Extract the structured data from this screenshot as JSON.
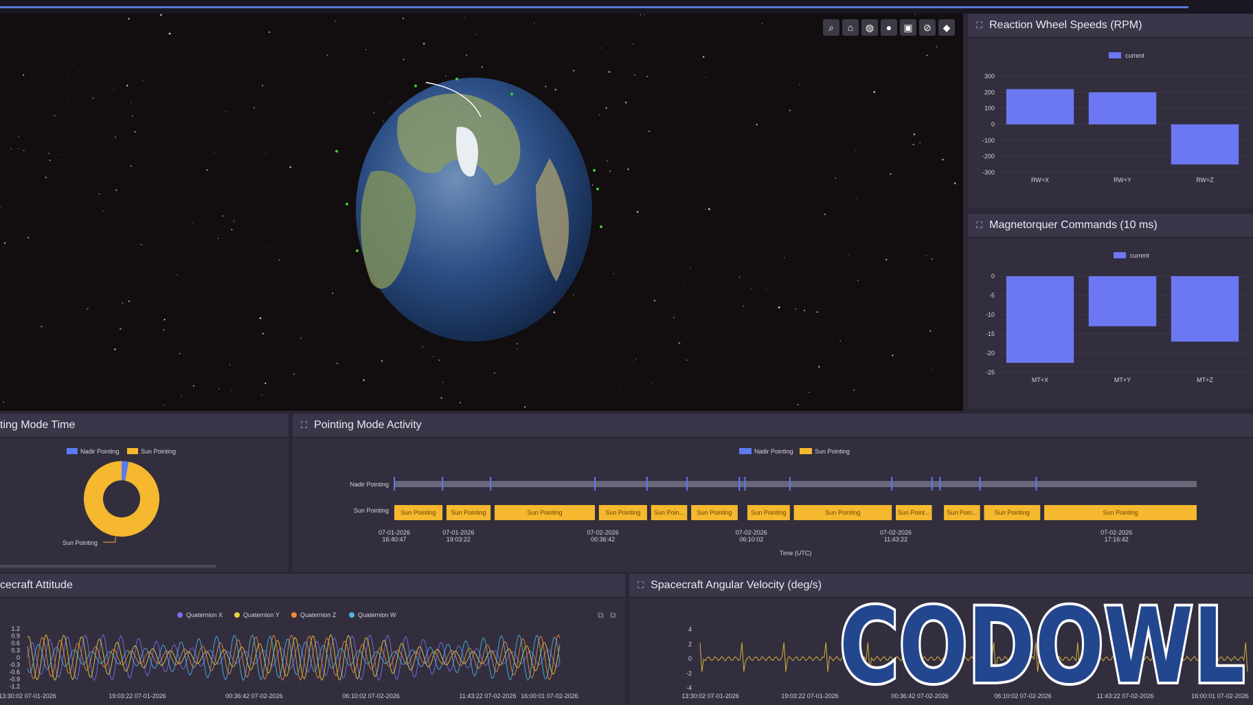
{
  "toolbar": {
    "buttons": [
      {
        "icon": "search-icon",
        "glyph": "⌕"
      },
      {
        "icon": "home-icon",
        "glyph": "⌂"
      },
      {
        "icon": "globe-icon",
        "glyph": "◍"
      },
      {
        "icon": "help-icon",
        "glyph": "●"
      },
      {
        "icon": "layers-icon",
        "glyph": "▣"
      },
      {
        "icon": "compass-icon",
        "glyph": "⊘"
      },
      {
        "icon": "settings-icon",
        "glyph": "◆"
      }
    ]
  },
  "panels": {
    "reaction_wheel": {
      "title": "Reaction Wheel Speeds (RPM)"
    },
    "magnetorquer": {
      "title": "Magnetorquer Commands (10 ms)"
    },
    "pointing_time": {
      "title": "ting Mode Time"
    },
    "pointing_activity": {
      "title": "Pointing Mode Activity"
    },
    "attitude": {
      "title": "cecraft Attitude"
    },
    "angular_velocity": {
      "title": "Spacecraft Angular Velocity (deg/s)"
    }
  },
  "colors": {
    "nadir": "#5b7bf0",
    "sun": "#f5b82e",
    "bar": "#6b78f2",
    "qx": "#7b6ff0",
    "qy": "#e8d23a",
    "qz": "#f08a3a",
    "qw": "#4fb3e8",
    "vel": "#d9b23a"
  },
  "chart_data": [
    {
      "type": "bar",
      "title": "Reaction Wheel Speeds (RPM)",
      "categories": [
        "RW+X",
        "RW+Y",
        "RW+Z"
      ],
      "series": [
        {
          "name": "current",
          "values": [
            220,
            200,
            -250
          ]
        }
      ],
      "yticks": [
        "300",
        "200",
        "100",
        "0",
        "-100",
        "-200",
        "-300"
      ],
      "ylim": [
        -300,
        300
      ]
    },
    {
      "type": "bar",
      "title": "Magnetorquer Commands (10 ms)",
      "categories": [
        "MT+X",
        "MT+Y",
        "MT+Z"
      ],
      "series": [
        {
          "name": "current",
          "values": [
            -22.5,
            -13,
            -17
          ]
        }
      ],
      "yticks": [
        "0",
        "-5",
        "-10",
        "-15",
        "-20",
        "-25"
      ],
      "ylim": [
        -25,
        0
      ]
    },
    {
      "type": "pie",
      "title": "ting Mode Time",
      "legend": [
        "Nadir Pointing",
        "Sun Pointing"
      ],
      "values": [
        3,
        97
      ],
      "slice_label": "Sun Pointing"
    },
    {
      "type": "bar",
      "title": "Pointing Mode Activity",
      "legend": [
        "Nadir Pointing",
        "Sun Pointing"
      ],
      "rows": [
        "Nadir Pointing",
        "Sun Pointing"
      ],
      "xlabel": "Time (UTC)",
      "xticks": [
        {
          "date": "07-01-2026",
          "time": "16:40:47"
        },
        {
          "date": "07-01-2026",
          "time": "19:03:22"
        },
        {
          "date": "07-02-2026",
          "time": "00:36:42"
        },
        {
          "date": "07-02-2026",
          "time": "06:10:02"
        },
        {
          "date": "07-02-2026",
          "time": "11:43:22"
        },
        {
          "date": "07-02-2026",
          "time": "17:16:42"
        }
      ],
      "nadir_marks": [
        0.0,
        0.06,
        0.12,
        0.25,
        0.315,
        0.365,
        0.43,
        0.437,
        0.493,
        0.62,
        0.67,
        0.68,
        0.73,
        0.8
      ],
      "sun_segments": [
        {
          "start": 0.0,
          "end": 0.06,
          "label": "Sun Pointing"
        },
        {
          "start": 0.065,
          "end": 0.12,
          "label": "Sun Pointing"
        },
        {
          "start": 0.125,
          "end": 0.25,
          "label": "Sun Pointing"
        },
        {
          "start": 0.255,
          "end": 0.315,
          "label": "Sun Pointing"
        },
        {
          "start": 0.32,
          "end": 0.365,
          "label": "Sun Poin..."
        },
        {
          "start": 0.37,
          "end": 0.428,
          "label": "Sun Pointing"
        },
        {
          "start": 0.44,
          "end": 0.493,
          "label": "Sun Pointing"
        },
        {
          "start": 0.498,
          "end": 0.62,
          "label": "Sun Pointing"
        },
        {
          "start": 0.625,
          "end": 0.67,
          "label": "Sun Point..."
        },
        {
          "start": 0.685,
          "end": 0.73,
          "label": "Sun Poin..."
        },
        {
          "start": 0.735,
          "end": 0.805,
          "label": "Sun Pointing"
        },
        {
          "start": 0.81,
          "end": 1.0,
          "label": "Sun Pointing"
        }
      ]
    },
    {
      "type": "line",
      "title": "cecraft Attitude",
      "series_names": [
        "Quaternion X",
        "Quaternion Y",
        "Quaternion Z",
        "Quaternion W"
      ],
      "yticks": [
        "1.2",
        "0.9",
        "0.6",
        "0.3",
        "0",
        "-0.3",
        "-0.6",
        "-0.9",
        "-1.2"
      ],
      "ylim": [
        -1.2,
        1.2
      ],
      "xticks": [
        "13:30:02 07-01-2026",
        "19:03:22 07-01-2026",
        "00:36:42 07-02-2026",
        "06:10:02 07-02-2026",
        "11:43:22 07-02-2026",
        "16:00:01 07-02-2026"
      ]
    },
    {
      "type": "line",
      "title": "Spacecraft Angular Velocity (deg/s)",
      "yticks": [
        "4",
        "2",
        "0",
        "-2",
        "-4"
      ],
      "ylim": [
        -4,
        4
      ],
      "xticks": [
        "13:30:02 07-01-2026",
        "19:03:22 07-01-2026",
        "00:36:42 07-02-2026",
        "06:10:02 07-02-2026",
        "11:43:22 07-02-2026",
        "16:00:01 07-02-2026"
      ]
    }
  ],
  "watermark": {
    "text": "CODOWL"
  }
}
